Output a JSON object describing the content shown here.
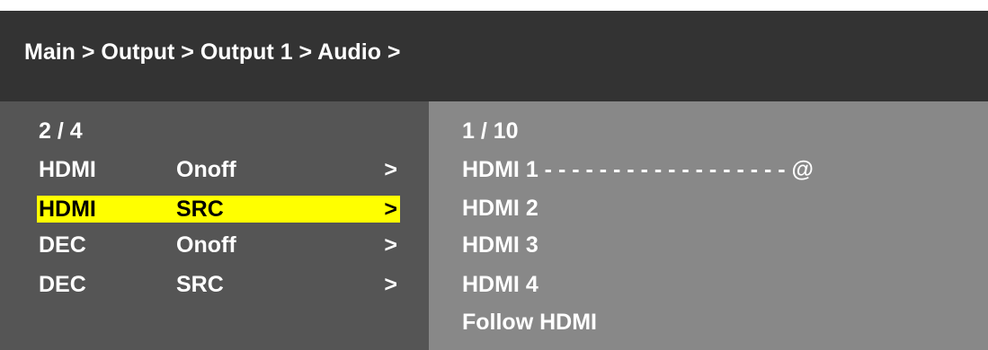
{
  "header": {
    "breadcrumb": "Main > Output > Output 1 > Audio >"
  },
  "left_menu": {
    "page_indicator": "2 / 4",
    "items": [
      {
        "col1": "HDMI",
        "col2": "Onoff",
        "arrow": ">"
      },
      {
        "col1": "HDMI",
        "col2": "SRC",
        "arrow": ">"
      },
      {
        "col1": "DEC",
        "col2": "Onoff",
        "arrow": ">"
      },
      {
        "col1": "DEC",
        "col2": "SRC",
        "arrow": ">"
      }
    ],
    "selected_index": 1
  },
  "right_menu": {
    "page_indicator": "1 / 10",
    "options": [
      "HDMI 1 - - - - - - - - - - - - - - - - - - @",
      "HDMI 2",
      "HDMI 3",
      "HDMI 4",
      "Follow HDMI"
    ]
  },
  "colors": {
    "header_bg": "#333333",
    "left_panel_bg": "#555555",
    "right_panel_bg": "#888888",
    "highlight": "#ffff00"
  }
}
